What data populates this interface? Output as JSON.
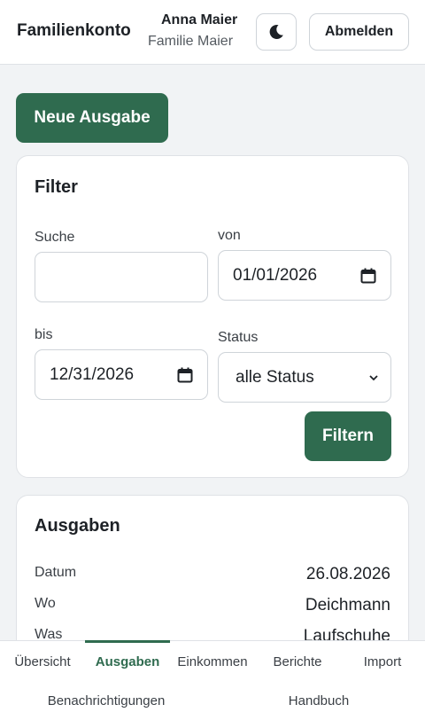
{
  "header": {
    "brand": "Familienkonto",
    "user_name": "Anna Maier",
    "family_name": "Familie Maier",
    "theme_icon": "moon-icon",
    "logout_label": "Abmelden"
  },
  "actions": {
    "new_expense_label": "Neue Ausgabe"
  },
  "filter": {
    "title": "Filter",
    "search_label": "Suche",
    "search_value": "",
    "from_label": "von",
    "from_value": "01/01/2026",
    "to_label": "bis",
    "to_value": "12/31/2026",
    "status_label": "Status",
    "status_value": "alle Status",
    "submit_label": "Filtern"
  },
  "expenses": {
    "title": "Ausgaben",
    "rows": [
      {
        "label": "Datum",
        "value": "26.08.2026"
      },
      {
        "label": "Wo",
        "value": "Deichmann"
      },
      {
        "label": "Was",
        "value": "Laufschuhe"
      }
    ]
  },
  "nav": {
    "items": [
      "Übersicht",
      "Ausgaben",
      "Einkommen",
      "Berichte",
      "Import",
      "Benachrichtigungen",
      "Handbuch"
    ],
    "active": "Ausgaben"
  },
  "colors": {
    "accent": "#2f6b4f",
    "background": "#f1f3f5"
  }
}
